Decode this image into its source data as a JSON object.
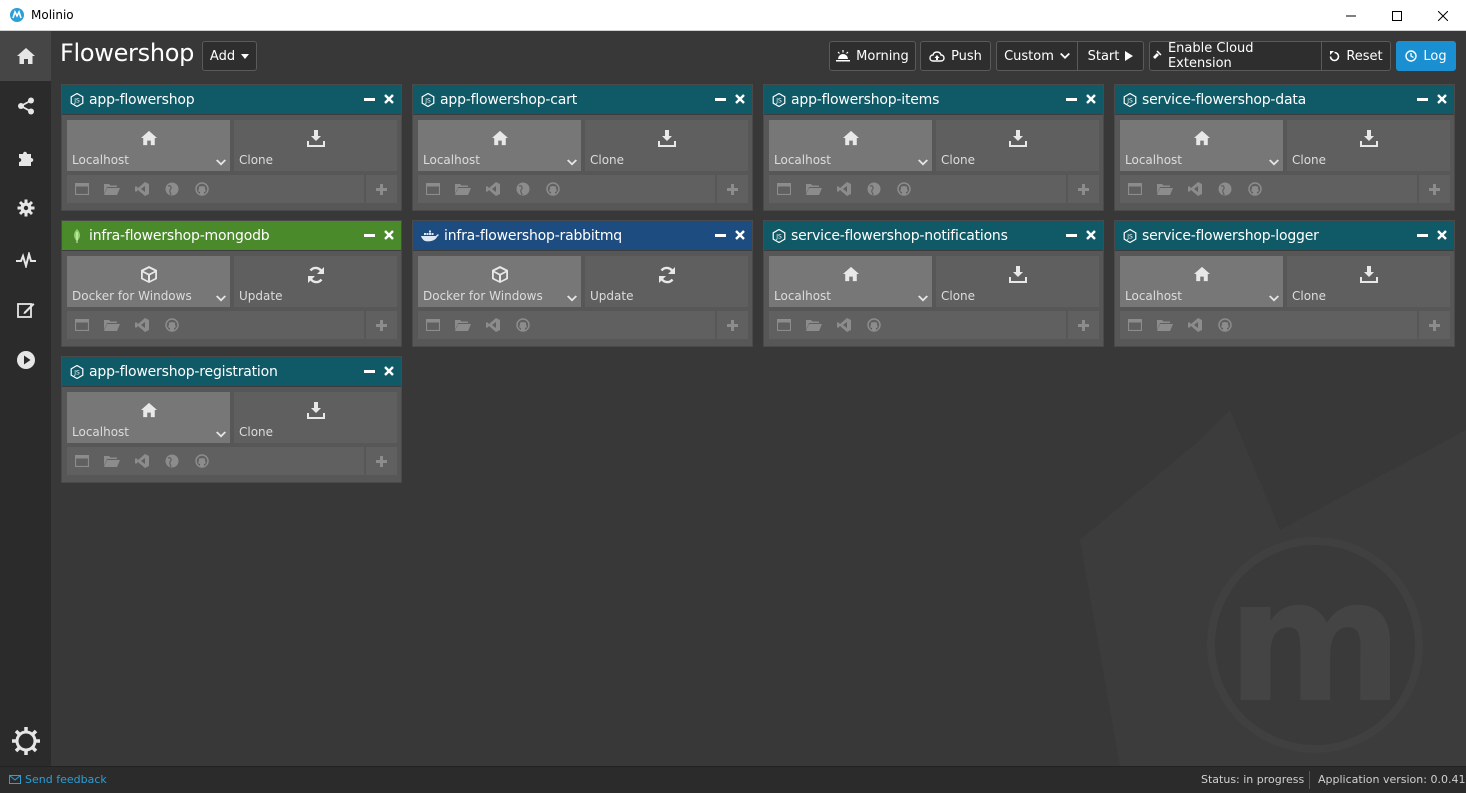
{
  "window": {
    "title": "Molinio"
  },
  "sidebar": {
    "items": [
      {
        "icon": "home-icon"
      },
      {
        "icon": "share-icon"
      },
      {
        "icon": "puzzle-icon"
      },
      {
        "icon": "gear-icon"
      },
      {
        "icon": "pulse-icon"
      },
      {
        "icon": "edit-icon"
      },
      {
        "icon": "play-icon"
      }
    ],
    "bottom_icon": "settings-sun-icon"
  },
  "header": {
    "title": "Flowershop",
    "add_label": "Add",
    "morning_label": "Morning",
    "push_label": "Push",
    "custom_label": "Custom",
    "start_label": "Start",
    "cloud_label": "Enable Cloud Extension",
    "reset_label": "Reset",
    "log_label": "Log"
  },
  "cards": [
    {
      "name": "app-flowershop",
      "kind": "node",
      "left_label": "Localhost",
      "right_label": "Clone",
      "tools": 5
    },
    {
      "name": "app-flowershop-cart",
      "kind": "node",
      "left_label": "Localhost",
      "right_label": "Clone",
      "tools": 5
    },
    {
      "name": "app-flowershop-items",
      "kind": "node",
      "left_label": "Localhost",
      "right_label": "Clone",
      "tools": 5
    },
    {
      "name": "service-flowershop-data",
      "kind": "node",
      "left_label": "Localhost",
      "right_label": "Clone",
      "tools": 5
    },
    {
      "name": "infra-flowershop-mongodb",
      "kind": "mongo",
      "left_label": "Docker for Windows",
      "right_label": "Update",
      "tools": 4
    },
    {
      "name": "infra-flowershop-rabbitmq",
      "kind": "docker",
      "left_label": "Docker for Windows",
      "right_label": "Update",
      "tools": 4
    },
    {
      "name": "service-flowershop-notifications",
      "kind": "node",
      "left_label": "Localhost",
      "right_label": "Clone",
      "tools": 4
    },
    {
      "name": "service-flowershop-logger",
      "kind": "node",
      "left_label": "Localhost",
      "right_label": "Clone",
      "tools": 4
    },
    {
      "name": "app-flowershop-registration",
      "kind": "node",
      "left_label": "Localhost",
      "right_label": "Clone",
      "tools": 5
    }
  ],
  "statusbar": {
    "feedback_label": "Send feedback",
    "status": "Status: in progress",
    "version": "Application version: 0.0.41"
  },
  "colors": {
    "accent": "#1a8fd1",
    "node_header": "#0f5a66",
    "mongo_header": "#4b8a2a",
    "docker_header": "#1d4d80"
  }
}
